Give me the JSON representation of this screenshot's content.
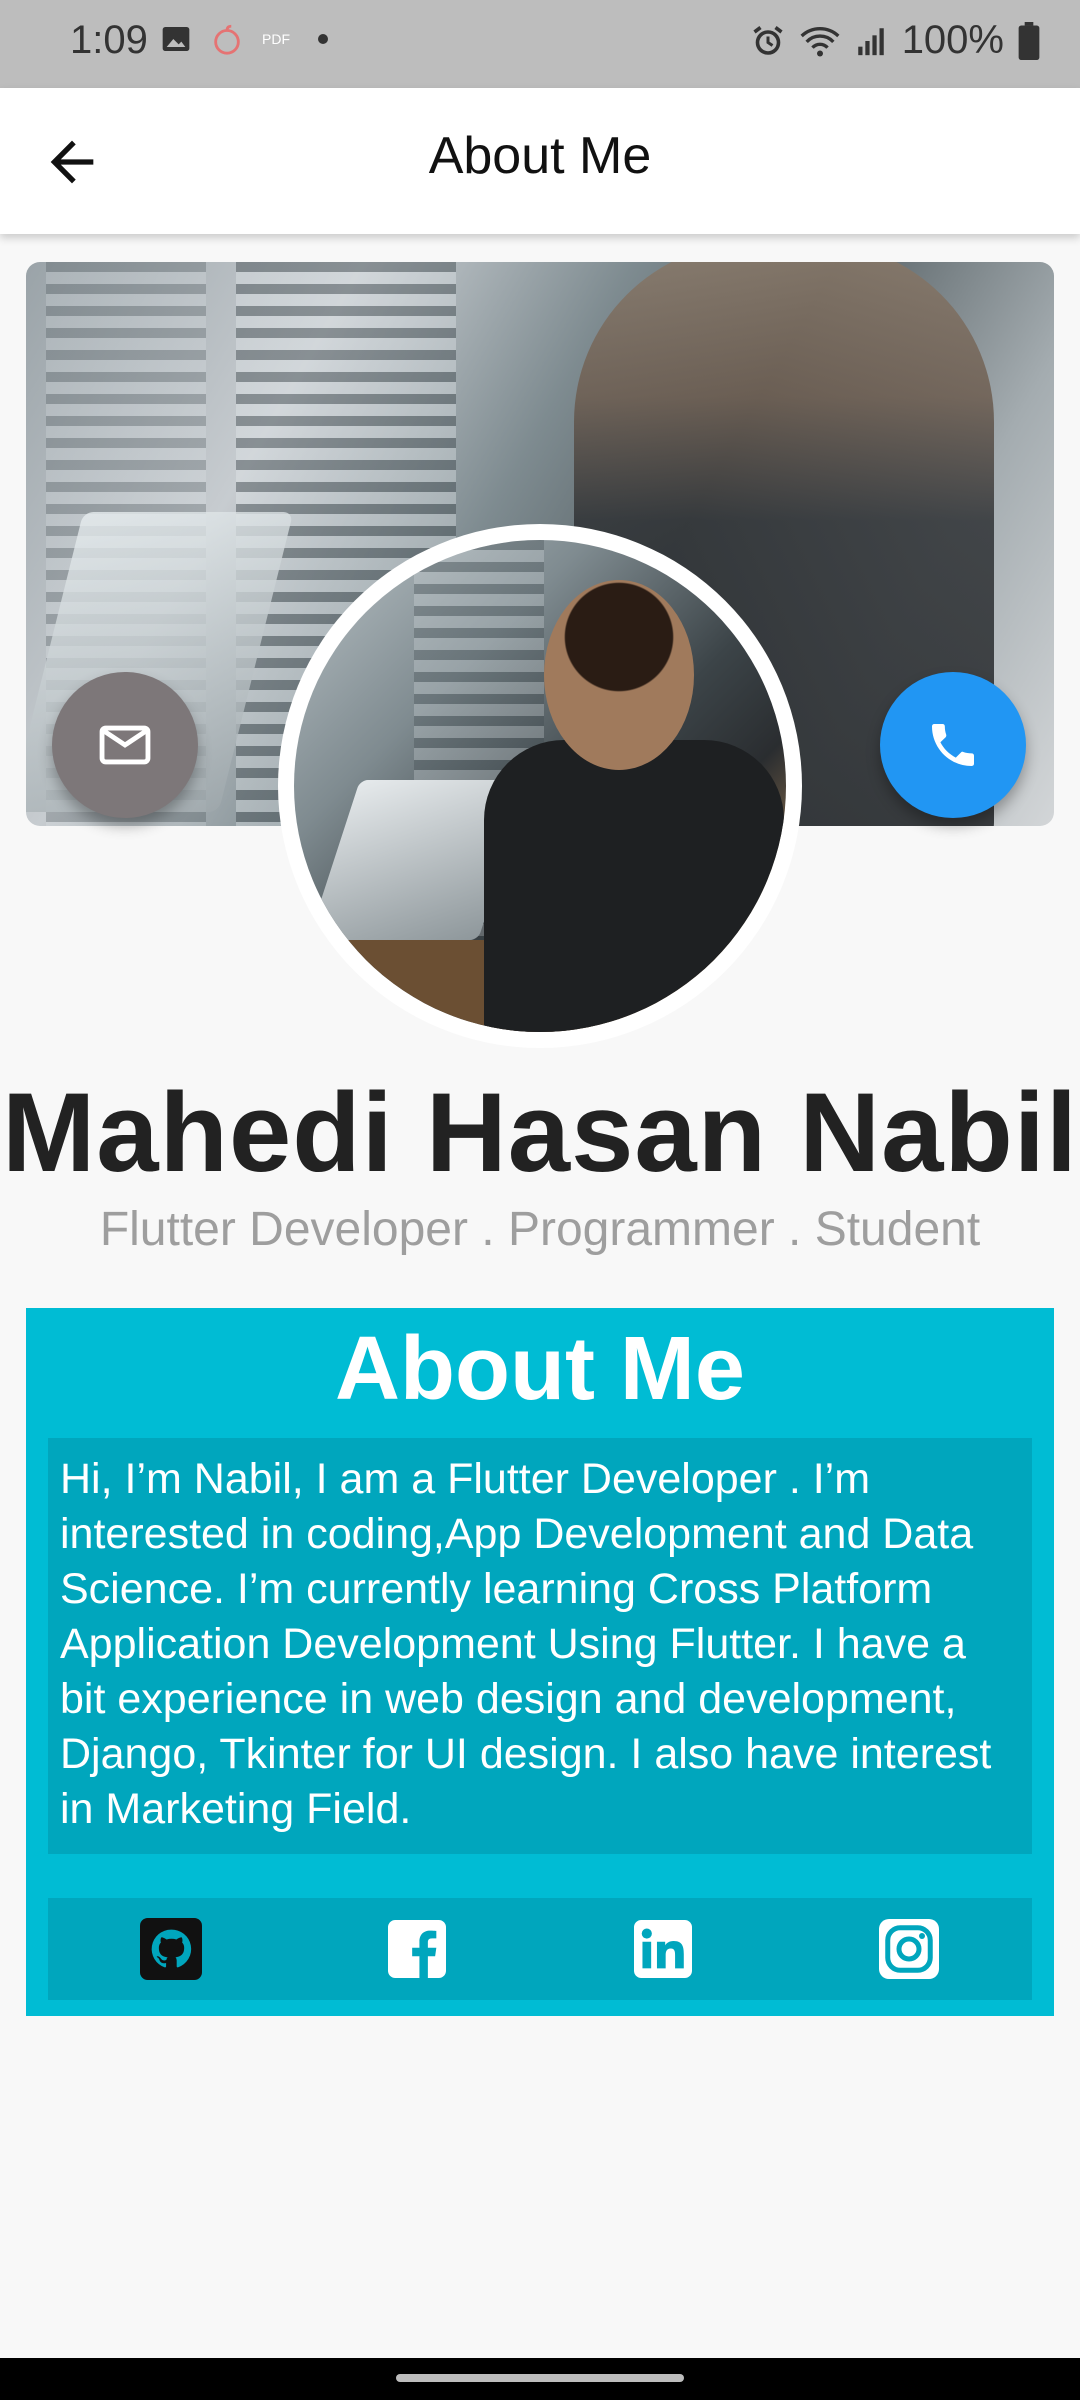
{
  "status_bar": {
    "time": "1:09",
    "battery": "100%",
    "icons": [
      "image-icon",
      "apple-icon",
      "pdf-icon",
      "dot-icon",
      "alarm-icon",
      "wifi-icon",
      "signal-icon",
      "battery-icon"
    ],
    "pdf_label": "PDF"
  },
  "app_bar": {
    "title": "About Me",
    "back_icon": "arrow-left-icon"
  },
  "profile": {
    "name": "Mahedi Hasan Nabil",
    "subtitle": "Flutter Developer . Programmer . Student",
    "mail_icon": "mail-icon",
    "phone_icon": "phone-icon"
  },
  "about": {
    "heading": "About Me",
    "text": "Hi, I’m Nabil, I am a Flutter Developer . I’m interested in coding,App Development and Data Science. I’m currently learning Cross Platform Application Development Using Flutter.  I have a bit experience in web design and development, Django, Tkinter for UI design. I also have interest in Marketing Field."
  },
  "social": [
    {
      "name": "github-icon"
    },
    {
      "name": "facebook-icon"
    },
    {
      "name": "linkedin-icon"
    },
    {
      "name": "instagram-icon"
    }
  ],
  "colors": {
    "accent": "#00bcd4",
    "accent_dark": "#00a6bd",
    "phone_fab": "#2196f3",
    "mail_fab": "#7d7779"
  }
}
